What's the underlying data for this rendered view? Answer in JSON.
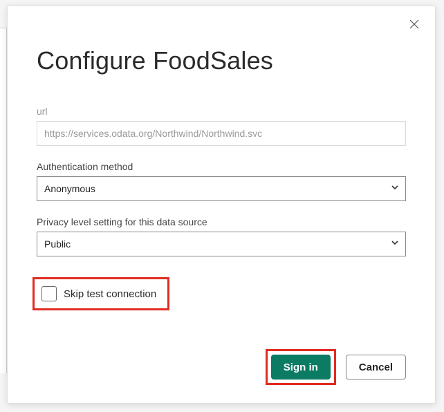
{
  "dialog": {
    "title": "Configure FoodSales",
    "url_label": "url",
    "url_value": "https://services.odata.org/Northwind/Northwind.svc",
    "auth_label": "Authentication method",
    "auth_value": "Anonymous",
    "privacy_label": "Privacy level setting for this data source",
    "privacy_value": "Public",
    "skip_label": "Skip test connection",
    "signin_label": "Sign in",
    "cancel_label": "Cancel"
  },
  "colors": {
    "accent": "#0b7b64",
    "highlight": "#e02b20"
  }
}
